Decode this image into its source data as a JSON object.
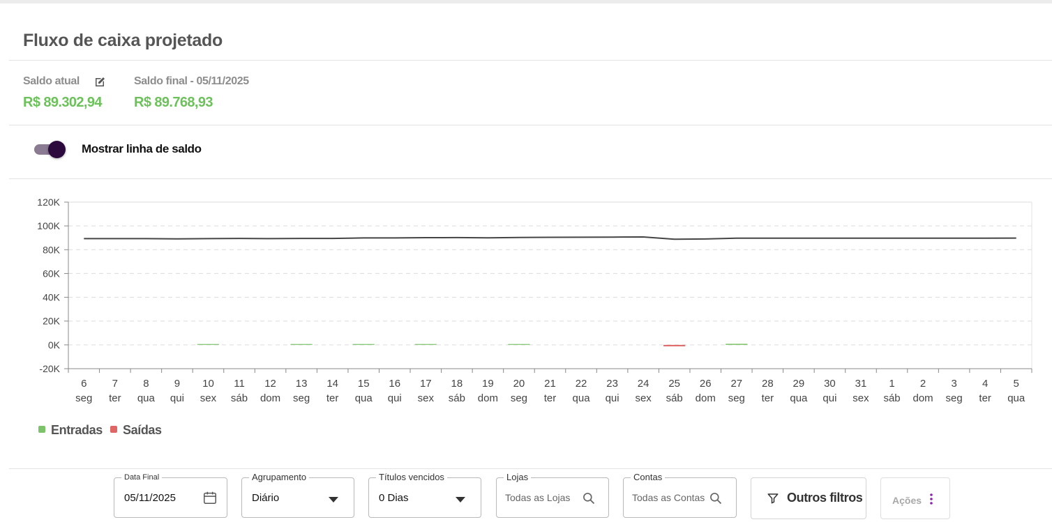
{
  "page": {
    "title": "Fluxo de caixa projetado"
  },
  "balances": {
    "current_label": "Saldo atual",
    "current_value": "R$ 89.302,94",
    "final_label": "Saldo final - 05/11/2025",
    "final_value": "R$ 89.768,93"
  },
  "toggle": {
    "label": "Mostrar linha de saldo",
    "on": true
  },
  "colors": {
    "entradas": "#7cc36a",
    "saidas": "#e06666",
    "balance_line": "#444444",
    "toggle_knob": "#2d0a3d",
    "value_green": "#6cc15b",
    "actions_dots": "#8e24aa"
  },
  "chart_data": {
    "type": "line",
    "ylim": [
      -20000,
      120000
    ],
    "yticks": [
      "-20K",
      "0K",
      "20K",
      "40K",
      "60K",
      "80K",
      "100K",
      "120K"
    ],
    "ytick_values": [
      -20000,
      0,
      20000,
      40000,
      60000,
      80000,
      100000,
      120000
    ],
    "grid": true,
    "legend_position": "bottom-left",
    "x_days": [
      "6",
      "7",
      "8",
      "9",
      "10",
      "11",
      "12",
      "13",
      "14",
      "15",
      "16",
      "17",
      "18",
      "19",
      "20",
      "21",
      "22",
      "23",
      "24",
      "25",
      "26",
      "27",
      "28",
      "29",
      "30",
      "31",
      "1",
      "2",
      "3",
      "4",
      "5"
    ],
    "x_weekdays": [
      "seg",
      "ter",
      "qua",
      "qui",
      "sex",
      "sáb",
      "dom",
      "seg",
      "ter",
      "qua",
      "qui",
      "sex",
      "sáb",
      "dom",
      "seg",
      "ter",
      "qua",
      "qui",
      "sex",
      "sáb",
      "dom",
      "seg",
      "ter",
      "qua",
      "qui",
      "sex",
      "sáb",
      "dom",
      "seg",
      "ter",
      "qua"
    ],
    "series": [
      {
        "name": "Entradas",
        "type": "bar",
        "color": "#7cc36a",
        "values": [
          0,
          0,
          0,
          0,
          400,
          0,
          0,
          300,
          0,
          500,
          0,
          300,
          0,
          0,
          400,
          0,
          0,
          0,
          0,
          0,
          0,
          900,
          0,
          0,
          0,
          0,
          0,
          0,
          0,
          0,
          0
        ]
      },
      {
        "name": "Saídas",
        "type": "bar",
        "color": "#e06666",
        "values": [
          0,
          0,
          0,
          0,
          0,
          0,
          0,
          0,
          0,
          0,
          0,
          0,
          0,
          0,
          0,
          0,
          0,
          0,
          0,
          -1200,
          0,
          0,
          0,
          0,
          0,
          0,
          0,
          0,
          0,
          0,
          0
        ]
      },
      {
        "type": "line",
        "color": "#444444",
        "values": [
          89303,
          89303,
          89303,
          89100,
          89303,
          89500,
          89300,
          89500,
          89500,
          89900,
          89900,
          90100,
          90200,
          90000,
          90300,
          90400,
          90500,
          90600,
          90700,
          88800,
          89000,
          89700,
          89700,
          89700,
          89700,
          89700,
          89700,
          89700,
          89700,
          89700,
          89769
        ]
      }
    ]
  },
  "legend": {
    "entradas": "Entradas",
    "saidas": "Saídas"
  },
  "filters": {
    "data_final": {
      "label": "Data Final",
      "value": "05/11/2025"
    },
    "agrupamento": {
      "label": "Agrupamento",
      "value": "Diário"
    },
    "titulos_vencidos": {
      "label": "Títulos vencidos",
      "value": "0 Dias"
    },
    "lojas": {
      "label": "Lojas",
      "placeholder": "Todas as Lojas"
    },
    "contas": {
      "label": "Contas",
      "placeholder": "Todas as Contas"
    },
    "outros_filtros": "Outros filtros",
    "acoes": "Ações"
  }
}
